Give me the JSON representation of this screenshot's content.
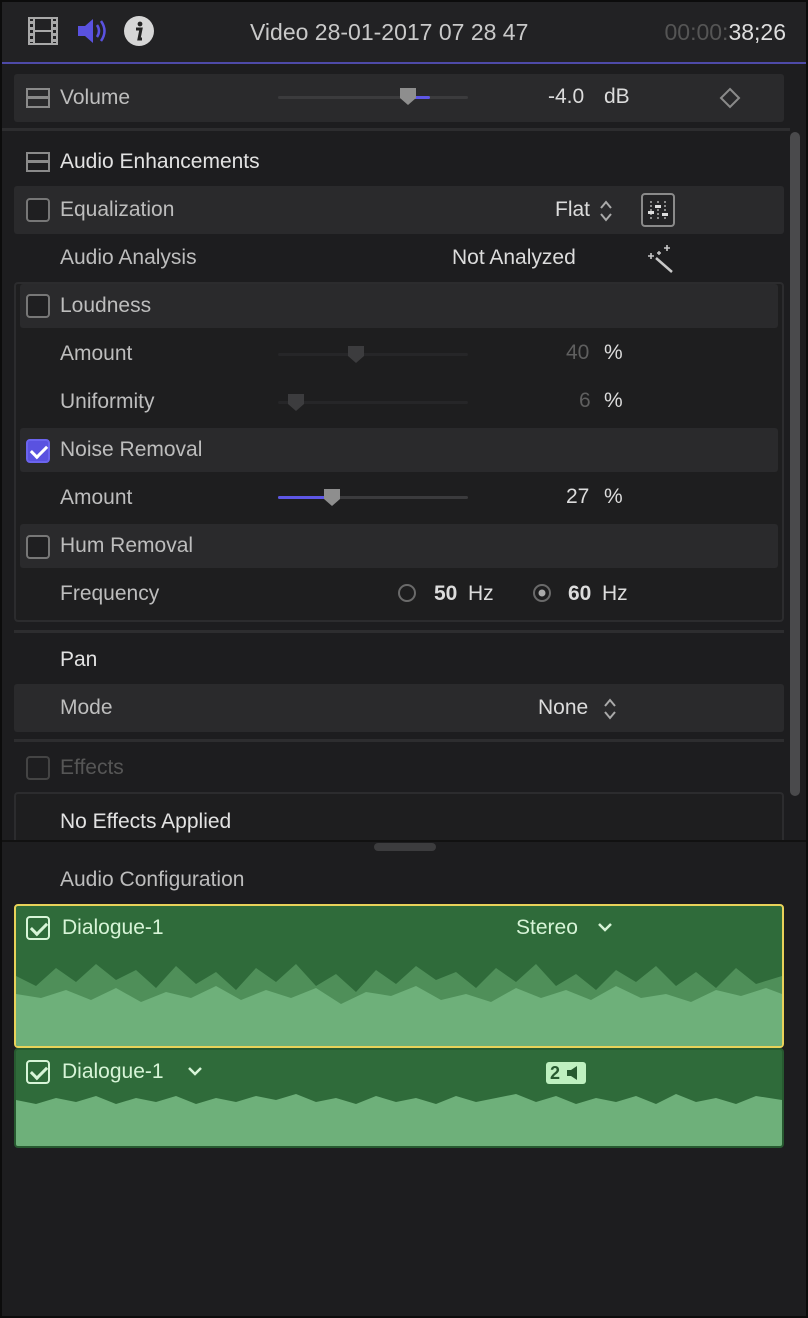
{
  "header": {
    "title": "Video 28-01-2017 07 28 47",
    "timecode_dim": "00:00:",
    "timecode_main": "38;26",
    "icons": [
      "film-icon",
      "speaker-icon",
      "info-icon"
    ],
    "accent_color": "#5a52e0"
  },
  "volume": {
    "label": "Volume",
    "value": "-4.0",
    "unit": "dB"
  },
  "enhancements": {
    "title": "Audio Enhancements",
    "equalization": {
      "label": "Equalization",
      "value": "Flat",
      "checked": false
    },
    "analysis": {
      "label": "Audio Analysis",
      "value": "Not Analyzed"
    },
    "loudness": {
      "label": "Loudness",
      "checked": false,
      "amount_label": "Amount",
      "amount_value": "40",
      "amount_unit": "%",
      "uniformity_label": "Uniformity",
      "uniformity_value": "6",
      "uniformity_unit": "%"
    },
    "noise": {
      "label": "Noise Removal",
      "checked": true,
      "amount_label": "Amount",
      "amount_value": "27",
      "amount_unit": "%"
    },
    "hum": {
      "label": "Hum Removal",
      "checked": false,
      "frequency_label": "Frequency",
      "option1": "50",
      "option1_unit": "Hz",
      "option2": "60",
      "option2_unit": "Hz",
      "selected": "60 Hz"
    }
  },
  "pan": {
    "title": "Pan",
    "mode_label": "Mode",
    "mode_value": "None"
  },
  "effects": {
    "label": "Effects",
    "empty_text": "No Effects Applied"
  },
  "audio_config": {
    "title": "Audio Configuration",
    "clip1": {
      "label": "Dialogue-1",
      "channel": "Stereo"
    },
    "clip2": {
      "label": "Dialogue-1",
      "badge": "2"
    }
  }
}
